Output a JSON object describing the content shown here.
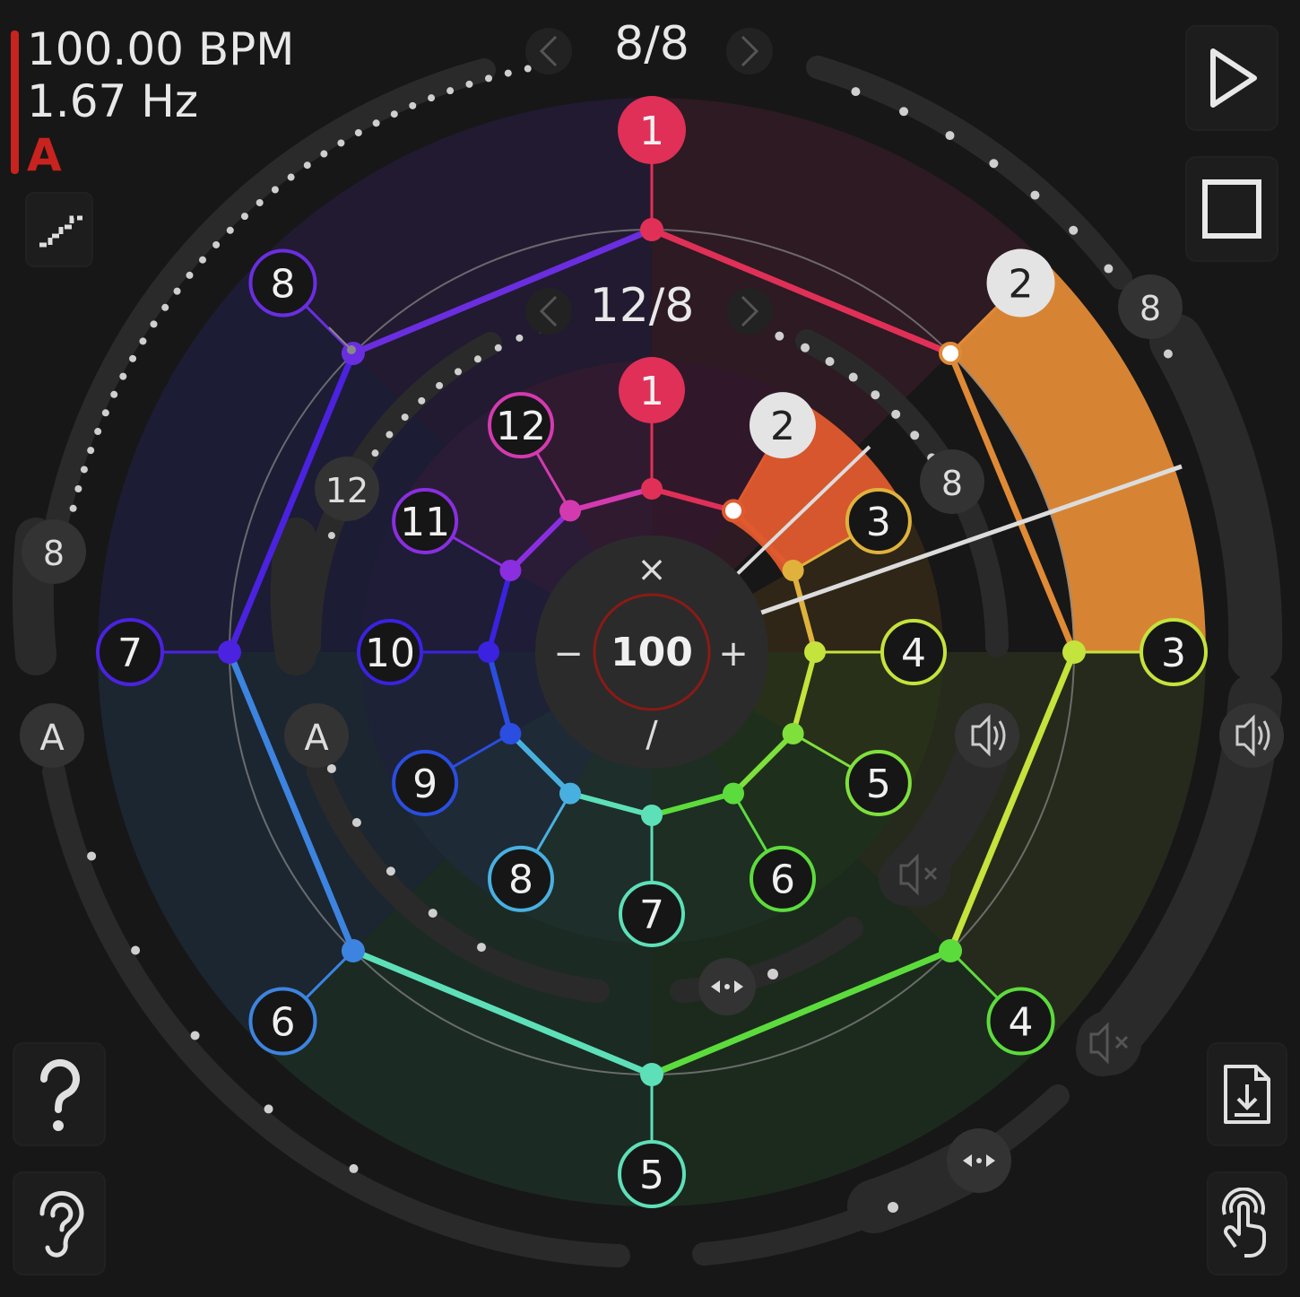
{
  "readout": {
    "bpm": "100.00 BPM",
    "hz": "1.67 Hz",
    "preset": "A"
  },
  "outer_meter": {
    "label": "8/8",
    "steps": [
      "1",
      "2",
      "3",
      "4",
      "5",
      "6",
      "7",
      "8"
    ]
  },
  "inner_meter": {
    "label": "12/8",
    "steps": [
      "1",
      "2",
      "3",
      "4",
      "5",
      "6",
      "7",
      "8",
      "9",
      "10",
      "11",
      "12"
    ]
  },
  "center": {
    "value": "100",
    "minus": "−",
    "plus": "+",
    "multiply": "×",
    "divide": "∕"
  },
  "ring_badges": {
    "outer_right": "8",
    "inner_right": "8",
    "outer_left": "8",
    "inner_left": "12",
    "ghost": "8",
    "outer_left_preset": "A",
    "inner_left_preset": "A"
  },
  "icons": [
    "stairs-icon",
    "play-icon",
    "stop-icon",
    "help-icon",
    "ear-icon",
    "download-file-icon",
    "touch-icon",
    "speaker-icon",
    "mute-icon",
    "swap-icon"
  ],
  "colors": {
    "accent": "#c8231e",
    "background": "#171717",
    "beat1": "#e03058",
    "active_step": "#e08a36"
  }
}
